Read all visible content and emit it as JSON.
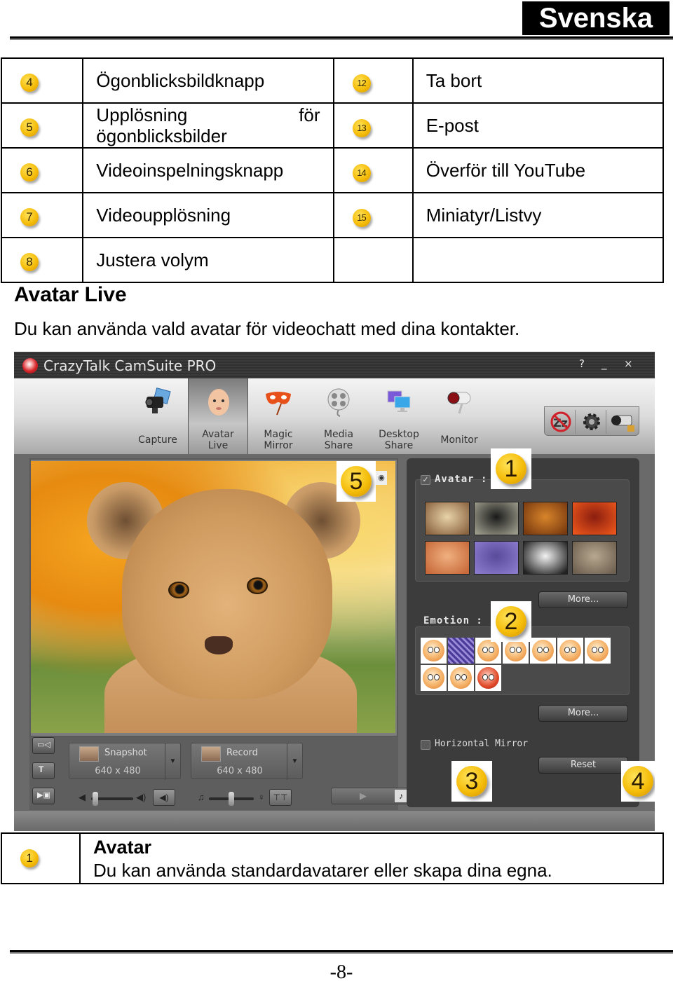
{
  "header": {
    "language": "Svenska"
  },
  "legend": [
    {
      "left": {
        "num": "4",
        "label": "Ögonblicksbildknapp"
      },
      "right": {
        "num": "12",
        "label": "Ta bort"
      }
    },
    {
      "left": {
        "num": "5",
        "label": "Upplösning för ögonblicksbilder",
        "label_line1_a": "Upplösning",
        "label_line1_b": "för",
        "label_line2": "ögonblicksbilder"
      },
      "right": {
        "num": "13",
        "label": "E-post"
      }
    },
    {
      "left": {
        "num": "6",
        "label": "Videoinspelningsknapp"
      },
      "right": {
        "num": "14",
        "label": "Överför till YouTube"
      }
    },
    {
      "left": {
        "num": "7",
        "label": "Videoupplösning"
      },
      "right": {
        "num": "15",
        "label": "Miniatyr/Listvy"
      }
    },
    {
      "left": {
        "num": "8",
        "label": "Justera volym"
      },
      "right": {
        "num": "",
        "label": ""
      }
    }
  ],
  "section": {
    "title": "Avatar Live",
    "description": "Du kan använda vald avatar för videochatt med dina kontakter."
  },
  "app": {
    "title": "CrazyTalk CamSuite PRO",
    "window_buttons": {
      "help": "?",
      "minimize": "_",
      "close": "×"
    },
    "tools": [
      {
        "id": "capture",
        "label1": "Capture",
        "label2": "",
        "icon": "camera-icon"
      },
      {
        "id": "avatar-live",
        "label1": "Avatar",
        "label2": "Live",
        "icon": "baby-face-icon",
        "active": true
      },
      {
        "id": "magic-mirror",
        "label1": "Magic",
        "label2": "Mirror",
        "icon": "mask-icon"
      },
      {
        "id": "media-share",
        "label1": "Media",
        "label2": "Share",
        "icon": "film-reel-icon"
      },
      {
        "id": "desktop-share",
        "label1": "Desktop",
        "label2": "Share",
        "icon": "monitors-icon"
      },
      {
        "id": "monitor",
        "label1": "Monitor",
        "label2": "",
        "icon": "security-camera-icon"
      }
    ],
    "quick_buttons": [
      "no-sleep-icon",
      "gear-icon",
      "webcam-lock-icon"
    ],
    "callouts": {
      "c1": "1",
      "c2": "2",
      "c3": "3",
      "c4": "4",
      "c5": "5"
    },
    "snapshot": {
      "label": "Snapshot",
      "resolution": "640 x 480"
    },
    "record": {
      "label": "Record",
      "resolution": "640 x 480"
    },
    "volume_level": 0.1,
    "mic_level": 0.5,
    "avatar_panel": {
      "title": "Avatar :",
      "checked": true,
      "avatars": [
        {
          "name": "ventriloquist-dummy",
          "colors": [
            "#e8d2a8",
            "#8a6440"
          ]
        },
        {
          "name": "skull-figure",
          "colors": [
            "#1a1a1a",
            "#9a9a8a"
          ]
        },
        {
          "name": "old-man",
          "colors": [
            "#d8852a",
            "#7a3a10"
          ]
        },
        {
          "name": "red-demon",
          "colors": [
            "#8a1e10",
            "#e8541a"
          ]
        },
        {
          "name": "doll-girl",
          "colors": [
            "#f0b080",
            "#c86a3a"
          ]
        },
        {
          "name": "purple-pattern",
          "colors": [
            "#5a4a9a",
            "#8a7acb"
          ]
        },
        {
          "name": "panda",
          "colors": [
            "#f2f2f2",
            "#222222"
          ]
        },
        {
          "name": "king-statue",
          "colors": [
            "#b8a890",
            "#6e6050"
          ]
        }
      ],
      "more_label": "More..."
    },
    "emotion_panel": {
      "title": "Emotion :",
      "emotions": [
        "angry-wink",
        "selected",
        "sleepy",
        "kiss",
        "singing",
        "surprised",
        "sick",
        "happy",
        "laughing",
        "furious"
      ],
      "more_label": "More..."
    },
    "horizontal_mirror": {
      "label": "Horizontal Mirror",
      "checked": false
    },
    "reset_label": "Reset"
  },
  "description_table": {
    "num": "1",
    "title": "Avatar",
    "body": "Du kan använda standardavatarer eller skapa dina egna."
  },
  "footer": {
    "page_number": "-8-"
  }
}
